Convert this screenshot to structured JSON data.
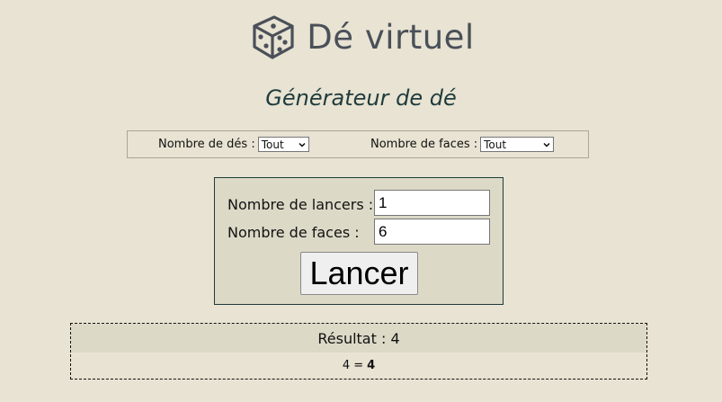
{
  "header": {
    "title": "Dé virtuel",
    "logo_icon": "dice-icon"
  },
  "subtitle": "Générateur de dé",
  "filters": {
    "dice_count_label": "Nombre de dés :",
    "dice_count_value": "Tout",
    "faces_label": "Nombre de faces :",
    "faces_value": "Tout"
  },
  "form": {
    "rolls_label": "Nombre de lancers :",
    "rolls_value": "1",
    "faces_label": "Nombre de faces :",
    "faces_value": "6",
    "submit_label": "Lancer"
  },
  "result": {
    "label": "Résultat : 4",
    "expression": "4 =",
    "total": "4"
  },
  "colors": {
    "background": "#e8e3d2",
    "panel": "#dcd9c7",
    "title": "#4a5059",
    "subtitle": "#1f3b3d"
  }
}
